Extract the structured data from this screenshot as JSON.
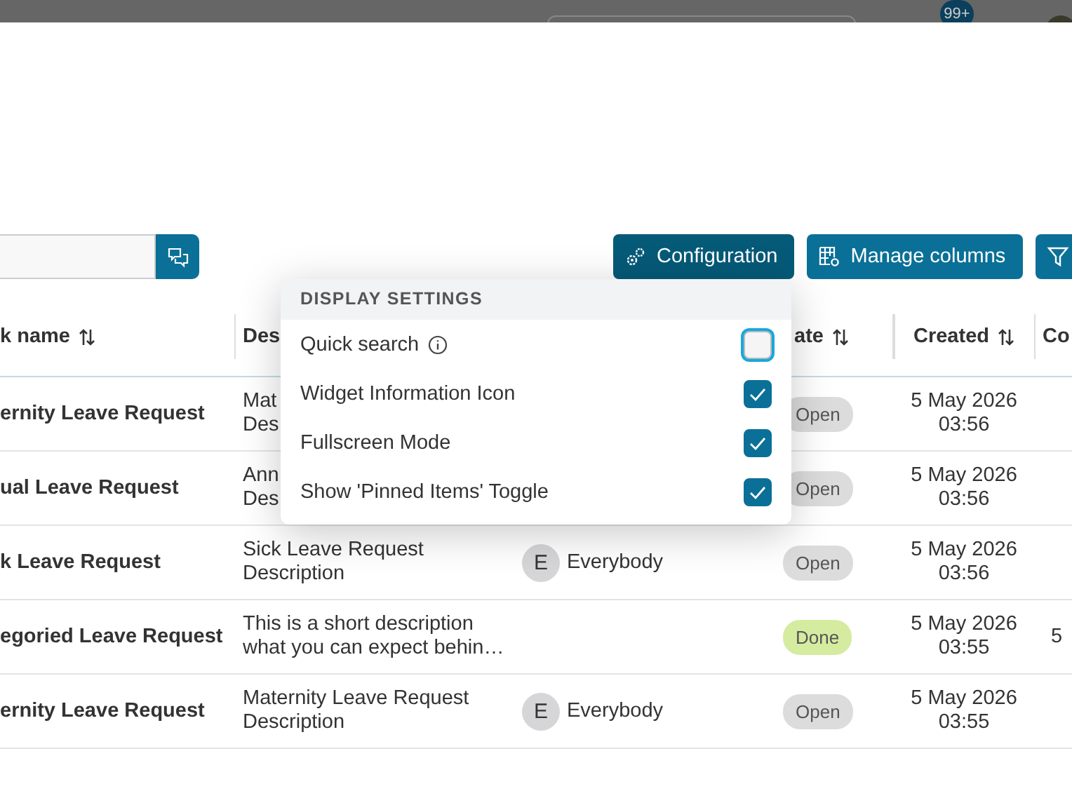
{
  "top_bar": {
    "notification_badge": "99+"
  },
  "toolbar": {
    "buttons": [
      {
        "label": "Configuration",
        "selected": true
      },
      {
        "label": "Manage columns",
        "selected": false
      },
      {
        "selected": false
      }
    ]
  },
  "display_settings": {
    "title": "DISPLAY SETTINGS",
    "items": [
      {
        "label": "Quick search",
        "info": true,
        "checked": false
      },
      {
        "label": "Widget Information Icon",
        "info": false,
        "checked": true
      },
      {
        "label": "Fullscreen Mode",
        "info": false,
        "checked": true
      },
      {
        "label": "Show 'Pinned Items' Toggle",
        "info": false,
        "checked": true
      }
    ]
  },
  "table": {
    "columns": [
      {
        "label": "k name",
        "sortable": true
      },
      {
        "label": "Des",
        "sortable": false
      },
      null,
      {
        "label": "ate",
        "sortable": true
      },
      {
        "label": "Created",
        "sortable": true
      },
      {
        "label": "Co",
        "sortable": false
      }
    ],
    "rows": [
      {
        "name": "ernity Leave Request",
        "description": [
          "Mat",
          "Des"
        ],
        "assignee": null,
        "status": {
          "label": "Open",
          "kind": "open"
        },
        "created": [
          "5 May 2026",
          "03:56"
        ]
      },
      {
        "name": "ual Leave Request",
        "description": [
          "Ann",
          "Des"
        ],
        "assignee": null,
        "status": {
          "label": "Open",
          "kind": "open"
        },
        "created": [
          "5 May 2026",
          "03:56"
        ]
      },
      {
        "name": "k Leave Request",
        "description": [
          "Sick Leave Request",
          "Description"
        ],
        "assignee": {
          "initial": "E",
          "name": "Everybody"
        },
        "status": {
          "label": "Open",
          "kind": "open"
        },
        "created": [
          "5 May 2026",
          "03:56"
        ]
      },
      {
        "name": "egoried Leave Request",
        "description": [
          "This is a short description",
          "what you can expect behin…"
        ],
        "assignee": null,
        "status": {
          "label": "Done",
          "kind": "done"
        },
        "created": [
          "5 May 2026",
          "03:55"
        ],
        "column_6": "5"
      },
      {
        "name": "ernity Leave Request",
        "description": [
          "Maternity Leave Request",
          "Description"
        ],
        "assignee": {
          "initial": "E",
          "name": "Everybody"
        },
        "status": {
          "label": "Open",
          "kind": "open"
        },
        "created": [
          "5 May 2026",
          "03:55"
        ]
      }
    ]
  }
}
